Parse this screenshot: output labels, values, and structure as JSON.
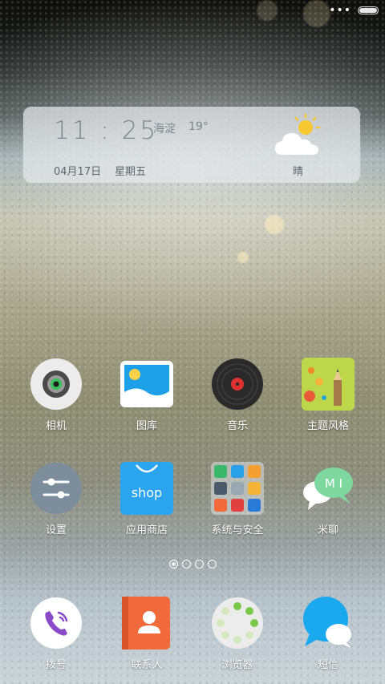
{
  "status": {
    "more_glyph": "•••"
  },
  "widget": {
    "time": "11 : 25",
    "location": "海淀",
    "temperature": "19°",
    "date": "04月17日",
    "weekday": "星期五",
    "condition": "晴",
    "weather_icon": "partly-sunny-icon"
  },
  "apps_row1": [
    {
      "label": "相机",
      "icon": "camera-icon"
    },
    {
      "label": "图库",
      "icon": "gallery-icon"
    },
    {
      "label": "音乐",
      "icon": "music-icon"
    },
    {
      "label": "主题风格",
      "icon": "themes-icon"
    }
  ],
  "apps_row2": [
    {
      "label": "设置",
      "icon": "settings-icon"
    },
    {
      "label": "应用商店",
      "icon": "app-store-icon",
      "text": "shop"
    },
    {
      "label": "系统与安全",
      "icon": "system-folder-icon"
    },
    {
      "label": "米聊",
      "icon": "mitalk-icon",
      "text": "M I"
    }
  ],
  "dock": [
    {
      "label": "拨号",
      "icon": "phone-icon"
    },
    {
      "label": "联系人",
      "icon": "contacts-icon"
    },
    {
      "label": "浏览器",
      "icon": "browser-icon"
    },
    {
      "label": "短信",
      "icon": "messages-icon"
    }
  ],
  "pages": {
    "count": 4,
    "active_index": 0
  },
  "colors": {
    "store_blue": "#2aa5ee",
    "contacts_orange": "#f06a3c",
    "sms_blue": "#1aa8ef",
    "theme_green": "#bcd84a",
    "music_red": "#e03030"
  }
}
